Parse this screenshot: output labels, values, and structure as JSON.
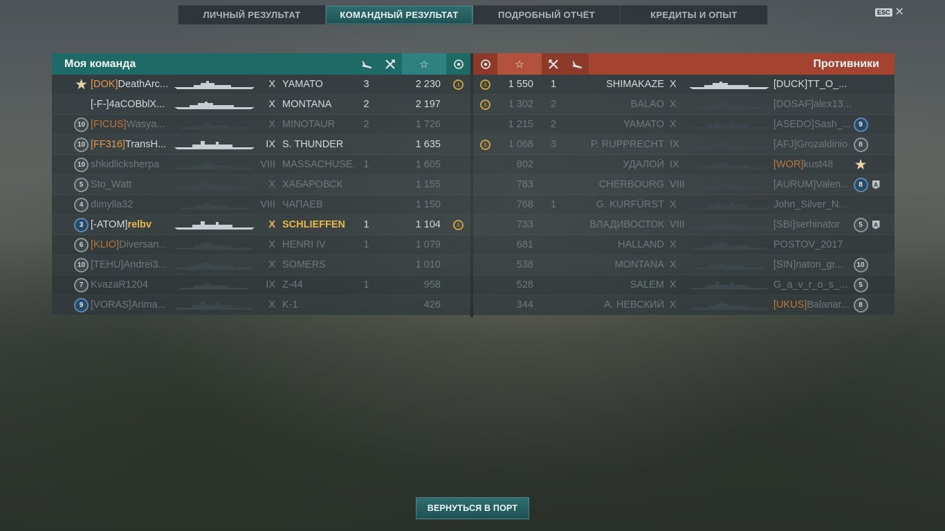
{
  "tabs": [
    {
      "label": "ЛИЧНЫЙ РЕЗУЛЬТАТ"
    },
    {
      "label": "КОМАНДНЫЙ РЕЗУЛЬТАТ"
    },
    {
      "label": "ПОДРОБНЫЙ ОТЧЁТ"
    },
    {
      "label": "КРЕДИТЫ И ОПЫТ"
    }
  ],
  "active_tab": 1,
  "esc": {
    "key": "ESC",
    "close": "✕"
  },
  "my_team": {
    "title": "Моя команда",
    "rows": [
      {
        "rank": "★",
        "rank_style": "star",
        "clan": "[DOK]",
        "clan_hl": true,
        "player": "DeathArc...",
        "tier": "X",
        "ship": "YAMATO",
        "planes": "3",
        "kills": "",
        "xp": "2 230",
        "medal": true,
        "dead": false,
        "me": false
      },
      {
        "rank": "",
        "rank_style": "none",
        "clan": "[-F-]",
        "clan_hl": false,
        "player": "4aCOBblX...",
        "tier": "X",
        "ship": "MONTANA",
        "planes": "2",
        "kills": "",
        "xp": "2 197",
        "medal": false,
        "dead": false,
        "me": false
      },
      {
        "rank": "10",
        "rank_style": "grey",
        "clan": "[FICUS]",
        "clan_hl": true,
        "player": "Wasya...",
        "tier": "X",
        "ship": "MINOTAUR",
        "planes": "2",
        "kills": "",
        "xp": "1 726",
        "medal": false,
        "dead": true,
        "me": false
      },
      {
        "rank": "10",
        "rank_style": "grey",
        "clan": "[FF316]",
        "clan_hl": true,
        "player": "TransH...",
        "tier": "IX",
        "ship": "S. THUNDER",
        "planes": "",
        "kills": "",
        "xp": "1 635",
        "medal": false,
        "dead": false,
        "me": false
      },
      {
        "rank": "10",
        "rank_style": "grey",
        "clan": "",
        "clan_hl": false,
        "player": "shkidlicksherpa",
        "tier": "VIII",
        "ship": "MASSACHUSE...",
        "planes": "1",
        "kills": "",
        "xp": "1 605",
        "medal": false,
        "dead": true,
        "me": false
      },
      {
        "rank": "5",
        "rank_style": "grey",
        "clan": "",
        "clan_hl": false,
        "player": "Sto_Watt",
        "tier": "X",
        "ship": "ХАБАРОВСК",
        "planes": "",
        "kills": "",
        "xp": "1 155",
        "medal": false,
        "dead": true,
        "me": false
      },
      {
        "rank": "4",
        "rank_style": "grey",
        "clan": "",
        "clan_hl": false,
        "player": "dimylla32",
        "tier": "VIII",
        "ship": "ЧАПАЕВ",
        "planes": "",
        "kills": "",
        "xp": "1 150",
        "medal": false,
        "dead": true,
        "me": false
      },
      {
        "rank": "3",
        "rank_style": "blue",
        "clan": "[-ATOM]",
        "clan_hl": false,
        "player": "relbv",
        "tier": "X",
        "ship": "SCHLIEFFEN",
        "planes": "1",
        "kills": "",
        "xp": "1 104",
        "medal": true,
        "dead": false,
        "me": true
      },
      {
        "rank": "6",
        "rank_style": "grey",
        "clan": "[KLIO]",
        "clan_hl": true,
        "player": "Diversan...",
        "tier": "X",
        "ship": "HENRI IV",
        "planes": "1",
        "kills": "",
        "xp": "1 079",
        "medal": false,
        "dead": true,
        "me": false
      },
      {
        "rank": "10",
        "rank_style": "grey",
        "clan": "[TEHU]",
        "clan_hl": false,
        "player": "Andrei3...",
        "tier": "X",
        "ship": "SOMERS",
        "planes": "",
        "kills": "",
        "xp": "1 010",
        "medal": false,
        "dead": true,
        "me": false
      },
      {
        "rank": "7",
        "rank_style": "grey",
        "clan": "",
        "clan_hl": false,
        "player": "KvazaR1204",
        "tier": "IX",
        "ship": "Z-44",
        "planes": "1",
        "kills": "",
        "xp": "958",
        "medal": false,
        "dead": true,
        "me": false
      },
      {
        "rank": "9",
        "rank_style": "blue",
        "clan": "[VORAS]",
        "clan_hl": false,
        "player": "Arima...",
        "tier": "X",
        "ship": "K-1",
        "planes": "",
        "kills": "",
        "xp": "426",
        "medal": false,
        "dead": true,
        "me": false
      }
    ]
  },
  "enemy_team": {
    "title": "Противники",
    "rows": [
      {
        "medal": true,
        "xp": "1 550",
        "kills": "1",
        "ship": "SHIMAKAZE",
        "tier": "X",
        "clan": "[DUCK]",
        "clan_hl": false,
        "player": "TT_O_...",
        "rank": "",
        "rank_style": "none",
        "ace": "",
        "dead": false
      },
      {
        "medal": true,
        "xp": "1 302",
        "kills": "2",
        "ship": "BALAO",
        "tier": "X",
        "clan": "[DOSAF]",
        "clan_hl": false,
        "player": "alex13...",
        "rank": "",
        "rank_style": "none",
        "ace": "",
        "dead": true
      },
      {
        "medal": false,
        "xp": "1 215",
        "kills": "2",
        "ship": "YAMATO",
        "tier": "X",
        "clan": "[ASEDO]",
        "clan_hl": false,
        "player": "Sash_...",
        "rank": "9",
        "rank_style": "blue",
        "ace": "",
        "dead": true
      },
      {
        "medal": true,
        "xp": "1 068",
        "kills": "3",
        "ship": "P. RUPPRECHT",
        "tier": "IX",
        "clan": "[AFJ]",
        "clan_hl": false,
        "player": "Grozaldinio",
        "rank": "8",
        "rank_style": "grey",
        "ace": "",
        "dead": true
      },
      {
        "medal": false,
        "xp": "802",
        "kills": "",
        "ship": "УДАЛОЙ",
        "tier": "IX",
        "clan": "[WOR]",
        "clan_hl": true,
        "player": "kust48",
        "rank": "★",
        "rank_style": "star",
        "ace": "",
        "dead": true
      },
      {
        "medal": false,
        "xp": "783",
        "kills": "",
        "ship": "CHERBOURG",
        "tier": "VIII",
        "clan": "[AURUM]",
        "clan_hl": false,
        "player": "Valen...",
        "rank": "8",
        "rank_style": "blue",
        "ace": "A",
        "dead": true
      },
      {
        "medal": false,
        "xp": "768",
        "kills": "1",
        "ship": "G. KURFÜRST",
        "tier": "X",
        "clan": "",
        "clan_hl": false,
        "player": "John_Silver_N...",
        "rank": "",
        "rank_style": "none",
        "ace": "",
        "dead": true
      },
      {
        "medal": false,
        "xp": "733",
        "kills": "",
        "ship": "ВЛАДИВОСТОК",
        "tier": "VIII",
        "clan": "[SBI]",
        "clan_hl": false,
        "player": "serhinator",
        "rank": "5",
        "rank_style": "grey",
        "ace": "A",
        "dead": true
      },
      {
        "medal": false,
        "xp": "681",
        "kills": "",
        "ship": "HALLAND",
        "tier": "X",
        "clan": "",
        "clan_hl": false,
        "player": "POSTOV_2017",
        "rank": "",
        "rank_style": "none",
        "ace": "",
        "dead": true
      },
      {
        "medal": false,
        "xp": "538",
        "kills": "",
        "ship": "MONTANA",
        "tier": "X",
        "clan": "[SIN]",
        "clan_hl": false,
        "player": "naton_gr...",
        "rank": "10",
        "rank_style": "grey",
        "ace": "",
        "dead": true
      },
      {
        "medal": false,
        "xp": "528",
        "kills": "",
        "ship": "SALEM",
        "tier": "X",
        "clan": "",
        "clan_hl": false,
        "player": "G_a_v_r_o_s_...",
        "rank": "5",
        "rank_style": "grey",
        "ace": "",
        "dead": true
      },
      {
        "medal": false,
        "xp": "344",
        "kills": "",
        "ship": "А. НЕВСКИЙ",
        "tier": "X",
        "clan": "[UKUS]",
        "clan_hl": true,
        "player": "Balanar...",
        "rank": "8",
        "rank_style": "grey",
        "ace": "",
        "dead": true
      }
    ]
  },
  "return_button": "ВЕРНУТЬСЯ В ПОРТ"
}
